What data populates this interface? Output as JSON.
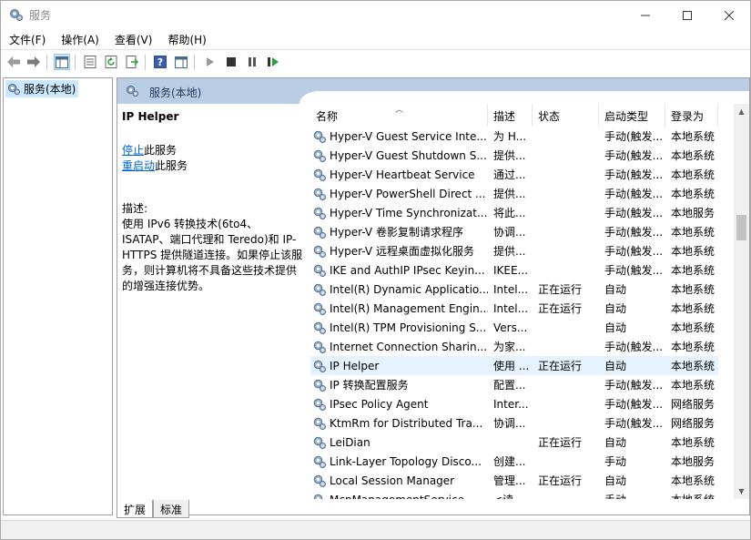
{
  "window": {
    "title": "服务"
  },
  "menu": [
    "文件(F)",
    "操作(A)",
    "查看(V)",
    "帮助(H)"
  ],
  "tree": {
    "root": "服务(本地)"
  },
  "pane_header": "服务(本地)",
  "detail": {
    "service_name": "IP Helper",
    "stop_link": "停止",
    "stop_suffix": "此服务",
    "restart_link": "重启动",
    "restart_suffix": "此服务",
    "desc_label": "描述:",
    "desc_text": "使用 IPv6 转换技术(6to4、ISATAP、端口代理和 Teredo)和 IP-HTTPS 提供隧道连接。如果停止该服务，则计算机将不具备这些技术提供的增强连接优势。"
  },
  "columns": {
    "name": "名称",
    "desc": "描述",
    "status": "状态",
    "startup": "启动类型",
    "logon": "登录为"
  },
  "rows": [
    {
      "name": "Hyper-V Guest Service Inte...",
      "desc": "为 H...",
      "status": "",
      "startup": "手动(触发...",
      "logon": "本地系统"
    },
    {
      "name": "Hyper-V Guest Shutdown S...",
      "desc": "提供...",
      "status": "",
      "startup": "手动(触发...",
      "logon": "本地系统"
    },
    {
      "name": "Hyper-V Heartbeat Service",
      "desc": "通过...",
      "status": "",
      "startup": "手动(触发...",
      "logon": "本地系统"
    },
    {
      "name": "Hyper-V PowerShell Direct ...",
      "desc": "提供...",
      "status": "",
      "startup": "手动(触发...",
      "logon": "本地系统"
    },
    {
      "name": "Hyper-V Time Synchronizat...",
      "desc": "将此...",
      "status": "",
      "startup": "手动(触发...",
      "logon": "本地服务"
    },
    {
      "name": "Hyper-V 卷影复制请求程序",
      "desc": "协调...",
      "status": "",
      "startup": "手动(触发...",
      "logon": "本地系统"
    },
    {
      "name": "Hyper-V 远程桌面虚拟化服务",
      "desc": "提供...",
      "status": "",
      "startup": "手动(触发...",
      "logon": "本地系统"
    },
    {
      "name": "IKE and AuthIP IPsec Keyin...",
      "desc": "IKEE...",
      "status": "",
      "startup": "手动(触发...",
      "logon": "本地系统"
    },
    {
      "name": "Intel(R) Dynamic Applicatio...",
      "desc": "Intel...",
      "status": "正在运行",
      "startup": "自动",
      "logon": "本地系统"
    },
    {
      "name": "Intel(R) Management Engin...",
      "desc": "Intel...",
      "status": "正在运行",
      "startup": "自动",
      "logon": "本地系统"
    },
    {
      "name": "Intel(R) TPM Provisioning S...",
      "desc": "Vers...",
      "status": "",
      "startup": "自动",
      "logon": "本地系统"
    },
    {
      "name": "Internet Connection Sharin...",
      "desc": "为家...",
      "status": "",
      "startup": "手动(触发...",
      "logon": "本地系统"
    },
    {
      "name": "IP Helper",
      "desc": "使用 ...",
      "status": "正在运行",
      "startup": "自动",
      "logon": "本地系统",
      "selected": true
    },
    {
      "name": "IP 转换配置服务",
      "desc": "配置...",
      "status": "",
      "startup": "手动(触发...",
      "logon": "本地系统"
    },
    {
      "name": "IPsec Policy Agent",
      "desc": "Inter...",
      "status": "",
      "startup": "手动(触发...",
      "logon": "网络服务"
    },
    {
      "name": "KtmRm for Distributed Tra...",
      "desc": "协调...",
      "status": "",
      "startup": "手动(触发...",
      "logon": "网络服务"
    },
    {
      "name": "LeiDian",
      "desc": "",
      "status": "正在运行",
      "startup": "自动",
      "logon": "本地系统"
    },
    {
      "name": "Link-Layer Topology Disco...",
      "desc": "创建...",
      "status": "",
      "startup": "手动",
      "logon": "本地服务"
    },
    {
      "name": "Local Session Manager",
      "desc": "管理...",
      "status": "正在运行",
      "startup": "自动",
      "logon": "本地系统"
    },
    {
      "name": "McpManagementService",
      "desc": "<读...",
      "status": "",
      "startup": "手动",
      "logon": "本地系统"
    }
  ],
  "tabs": [
    "扩展",
    "标准"
  ],
  "colors": {
    "header_bg": "#b9cde5",
    "selection": "#e5f3ff",
    "tree_selection": "#cce8ff",
    "link": "#0066cc"
  }
}
